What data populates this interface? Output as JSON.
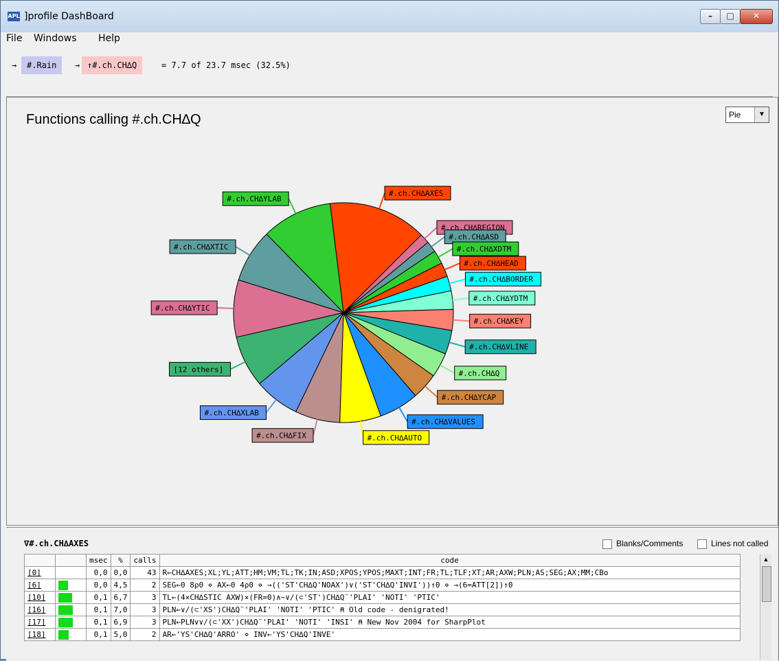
{
  "window": {
    "title": "]profile DashBoard",
    "icon": "APL"
  },
  "menu": {
    "file": "File",
    "windows": "Windows",
    "help": "Help"
  },
  "breadcrumb": {
    "arrow": "→",
    "root": "#.Rain",
    "current": "↑#.ch.CH∆Q",
    "summary": "= 7.7 of 23.7 msec (32.5%)",
    "root_color": "#c8c8f0",
    "current_color": "#f8c8c8"
  },
  "chart_panel": {
    "title": "Functions calling #.ch.CH∆Q",
    "view_select": "Pie"
  },
  "chart_data": {
    "type": "pie",
    "title": "Functions calling #.ch.CH∆Q",
    "slices": [
      {
        "label": "#.ch.CH∆AXES",
        "value": 16.0,
        "color": "#ff4500"
      },
      {
        "label": "#.ch.CH∆REGION",
        "value": 1.6,
        "color": "#db7093"
      },
      {
        "label": "#.ch.CH∆ASD",
        "value": 1.8,
        "color": "#5f9ea0"
      },
      {
        "label": "#.ch.CH∆XDTM",
        "value": 2.2,
        "color": "#32cd32"
      },
      {
        "label": "#.ch.CH∆HEAD",
        "value": 2.3,
        "color": "#ff4500"
      },
      {
        "label": "#.ch.CH∆BORDER",
        "value": 2.4,
        "color": "#00ffff"
      },
      {
        "label": "#.ch.CH∆YDTM",
        "value": 3.0,
        "color": "#7fffd4"
      },
      {
        "label": "#.ch.CH∆KEY",
        "value": 3.4,
        "color": "#fa8072"
      },
      {
        "label": "#.ch.CH∆VLINE",
        "value": 3.9,
        "color": "#20b2aa"
      },
      {
        "label": "#.ch.CH∆Q",
        "value": 4.0,
        "color": "#90ee90"
      },
      {
        "label": "#.ch.CH∆YCAP",
        "value": 4.3,
        "color": "#cd853f"
      },
      {
        "label": "#.ch.CH∆VALUES",
        "value": 6.5,
        "color": "#1e90ff"
      },
      {
        "label": "#.ch.CH∆AUTO",
        "value": 6.7,
        "color": "#ffff00"
      },
      {
        "label": "#.ch.CH∆FIX",
        "value": 7.3,
        "color": "#bc8f8f"
      },
      {
        "label": "#.ch.CH∆XLAB",
        "value": 7.4,
        "color": "#6495ed"
      },
      {
        "label": "[12 others]",
        "value": 8.4,
        "color": "#3cb371"
      },
      {
        "label": "#.ch.CH∆YTIC",
        "value": 9.3,
        "color": "#db7093"
      },
      {
        "label": "#.ch.CH∆XTIC",
        "value": 8.7,
        "color": "#5f9ea0"
      },
      {
        "label": "#.ch.CH∆YLAB",
        "value": 11.5,
        "color": "#32cd32"
      }
    ]
  },
  "detail": {
    "function_name": "∇#.ch.CH∆AXES",
    "blanks_label": "Blanks/Comments",
    "lines_not_called_label": "Lines not called",
    "columns": [
      "",
      "msec",
      "%",
      "calls",
      "code"
    ],
    "rows": [
      {
        "line": "[0]",
        "bar": 0.0,
        "msec": "0,0",
        "pct": "0,0",
        "calls": "43",
        "code": "R←CH∆AXES;XL;YL;ATT;HM;VM;TL;TK;IN;ASD;XPOS;YPOS;MAXT;INT;FR;TL;TLF;XT;AR;AXW;PLN;AS;SEG;AX;MM;CBo"
      },
      {
        "line": "[6]",
        "bar": 0.45,
        "msec": "0,0",
        "pct": "4,5",
        "calls": "2",
        "code": "SEG←0 8ρ0 ⋄ AX←0 4ρ0 ⋄ →(('ST'CH∆Q'NOAX')∨('ST'CH∆Q'INVI'))↑0 ⋄ →(6=ATT[2])↑0"
      },
      {
        "line": "[10]",
        "bar": 0.67,
        "msec": "0,1",
        "pct": "6,7",
        "calls": "3",
        "code": "TL←(4×CH∆STIC AXW)×(FR=0)∧~∨/(⊂'ST')CH∆Q¨'PLAI' 'NOTI' 'PTIC'"
      },
      {
        "line": "[16]",
        "bar": 0.7,
        "msec": "0,1",
        "pct": "7,0",
        "calls": "3",
        "code": "PLN←∨/(⊂'XS')CH∆Q¨'PLAI' 'NOTI' 'PTIC'           ⍝ Old code - denigrated!"
      },
      {
        "line": "[17]",
        "bar": 0.69,
        "msec": "0,1",
        "pct": "6,9",
        "calls": "3",
        "code": "PLN←PLN∨∨/(⊂'XX')CH∆Q¨'PLAI' 'NOTI' 'INSI'       ⍝ New Nov 2004 for SharpPlot"
      },
      {
        "line": "[18]",
        "bar": 0.5,
        "msec": "0,1",
        "pct": "5,0",
        "calls": "2",
        "code": "AR←'YS'CH∆Q'ARRO' ⋄ INV←'YS'CH∆Q'INVE'"
      }
    ]
  }
}
